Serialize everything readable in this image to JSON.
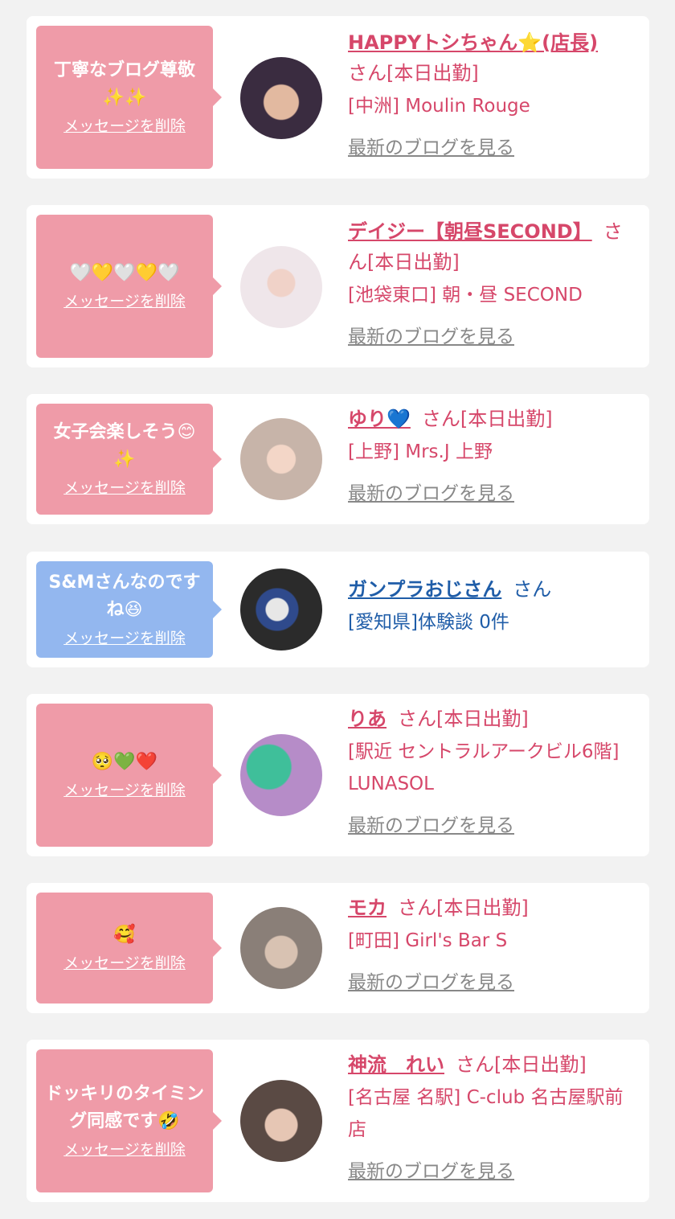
{
  "labels": {
    "delete_message": "メッセージを削除",
    "see_latest_blog": "最新のブログを見る",
    "san": "さん"
  },
  "items": [
    {
      "message": "丁寧なブログ尊敬",
      "message_emoji": "✨✨",
      "name": "HAPPYトシちゃん⭐(店長)",
      "status": "さん[本日出勤]",
      "shop": "[中洲] Moulin Rouge",
      "theme": "pink"
    },
    {
      "message": "",
      "message_emoji": "🤍💛🤍💛🤍",
      "name": "デイジー【朝昼SECOND】",
      "status": "さん[本日出勤]",
      "shop": "[池袋東口] 朝・昼 SECOND",
      "theme": "pink"
    },
    {
      "message": "女子会楽しそう😊",
      "message_emoji": "✨",
      "name": "ゆり💙",
      "status": "さん[本日出勤]",
      "shop": "[上野] Mrs.J 上野",
      "theme": "pink"
    },
    {
      "message": "S&Mさんなのですね😆",
      "message_emoji": "",
      "name": "ガンプラおじさん",
      "status": "さん",
      "shop": "[愛知県]体験談 0件",
      "theme": "blue"
    },
    {
      "message": "",
      "message_emoji": "🥺💚❤️",
      "name": "りあ",
      "status": "さん[本日出勤]",
      "shop": "[駅近 セントラルアークビル6階] LUNASOL",
      "theme": "pink"
    },
    {
      "message": "",
      "message_emoji": "🥰",
      "name": "モカ",
      "status": "さん[本日出勤]",
      "shop": "[町田] Girl's Bar S",
      "theme": "pink"
    },
    {
      "message": "ドッキリのタイミング同感です🤣",
      "message_emoji": "",
      "name": "神流　れい",
      "status": "さん[本日出勤]",
      "shop": "[名古屋 名駅] C-club 名古屋駅前店",
      "theme": "pink"
    }
  ],
  "colors": {
    "pink_bubble": "#ef9ba8",
    "blue_bubble": "#93b7ef",
    "name_pink": "#d6476a",
    "name_blue": "#1f5da8",
    "background": "#f2f2f2"
  }
}
